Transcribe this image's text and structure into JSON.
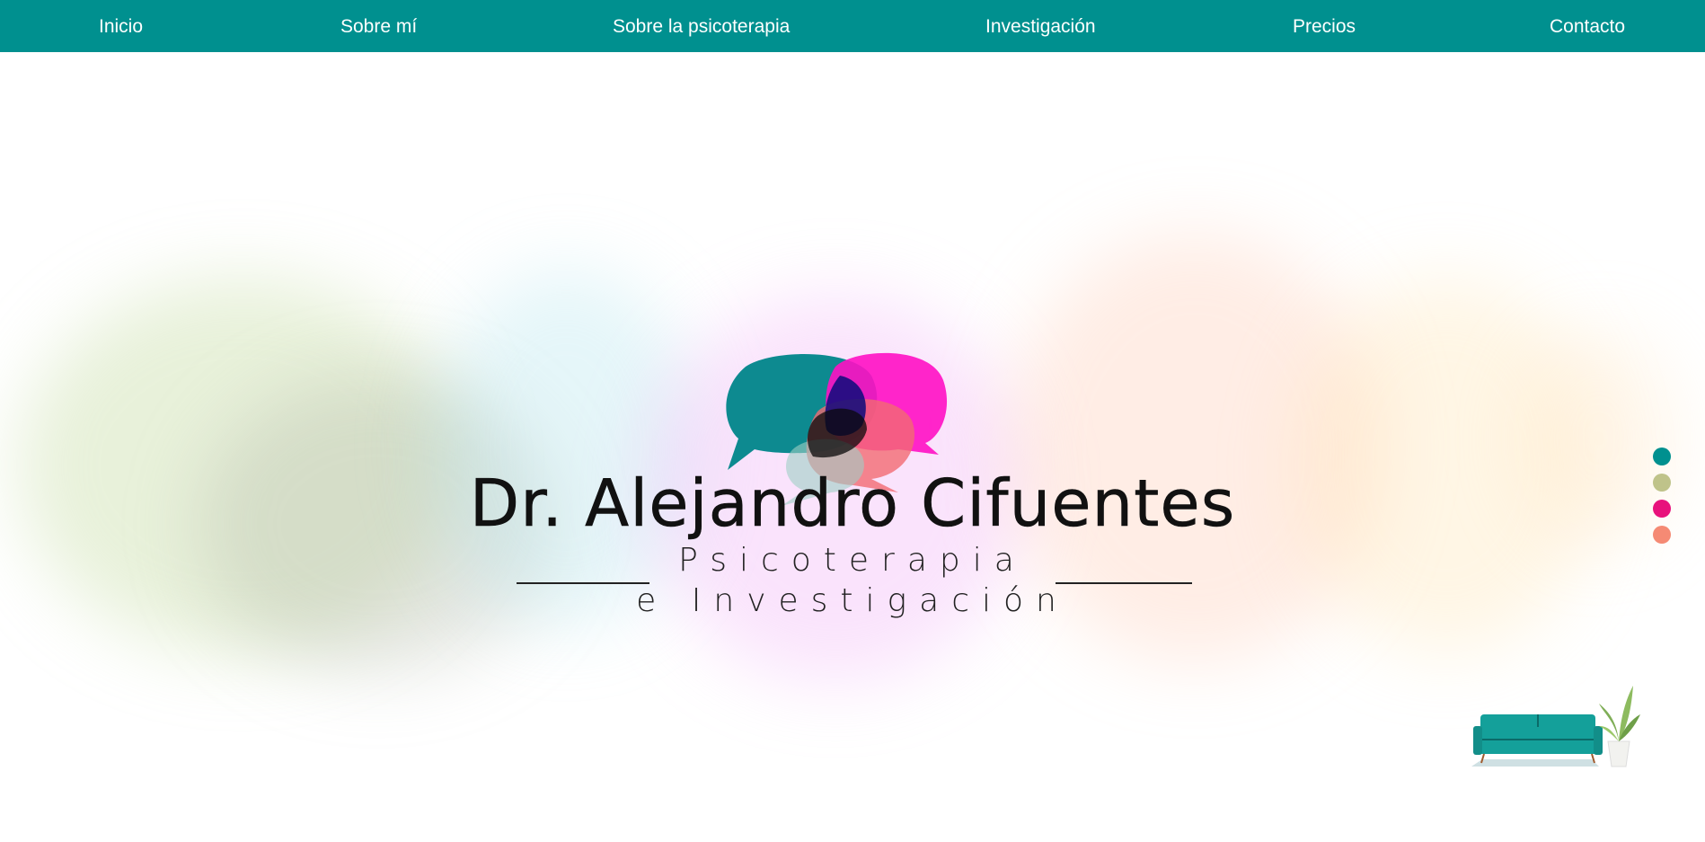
{
  "nav": {
    "items": [
      {
        "label": "Inicio"
      },
      {
        "label": "Sobre mí"
      },
      {
        "label": "Sobre la psicoterapia"
      },
      {
        "label": "Investigación"
      },
      {
        "label": "Precios"
      },
      {
        "label": "Contacto"
      }
    ],
    "background": "#00908f",
    "text_color": "#ffffff"
  },
  "hero": {
    "title": "Dr. Alejandro Cifuentes",
    "subtitle_line1": "Psicoterapia",
    "subtitle_line2": "e Investigación"
  },
  "slider_dots": [
    {
      "color": "#00908f"
    },
    {
      "color": "#bfc38a"
    },
    {
      "color": "#e8127c"
    },
    {
      "color": "#f58a74"
    }
  ],
  "logo": {
    "icon": "speech-bubbles-icon",
    "colors": [
      "#00858a",
      "#ff10c4",
      "#f26a72",
      "#9fcfc4"
    ]
  },
  "decoration": {
    "icon": "sofa-and-plant-icon",
    "sofa_color": "#14a09a"
  }
}
